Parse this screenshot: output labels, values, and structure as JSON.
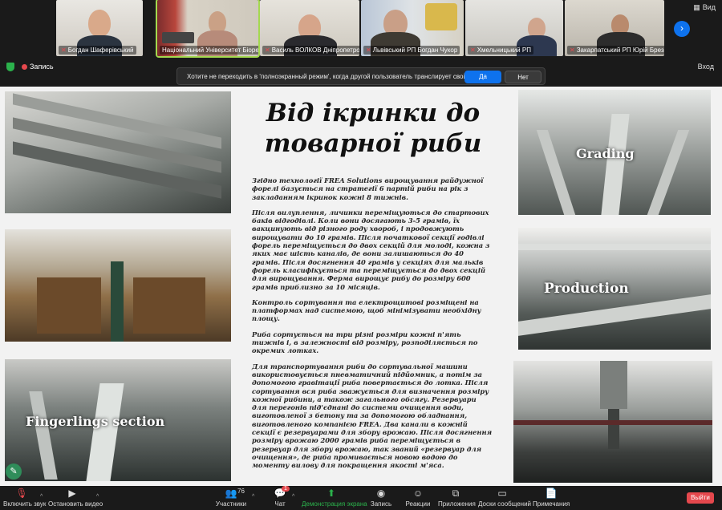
{
  "participants": [
    {
      "name": "Богдан Шаферівський"
    },
    {
      "name": "Національний Університет Біоресу..."
    },
    {
      "name": "Василь ВОЛКОВ Дніпропетровс..."
    },
    {
      "name": "Львівський РП Богдан Чукор"
    },
    {
      "name": "Хмельницький РП"
    },
    {
      "name": "Закарпатський РП Юрій Бреза"
    }
  ],
  "top_controls": {
    "view_label": "Вид",
    "exit_fullscreen_label": "Вход"
  },
  "recording": {
    "label": "Запись"
  },
  "prompt": {
    "question": "Хотите не переходить в 'полноэкранный режим', когда другой пользователь транслирует свой экран?",
    "yes_label": "Да",
    "no_label": "Нет"
  },
  "slide": {
    "title_line1": "Від ікринки до",
    "title_line2": "товарної риби",
    "paragraphs": [
      "Згідно технології FREA Solutions вирощування райдужної форелі базується на стратегії 6 партій риби на рік з закладанням ікринок кожні 8 тижнів.",
      "Після вилуплення, личинки переміщуються до стартових баків відгодівлі. Коли вони досягають 3-5 грамів, їх вакцинують від різного роду хвороб, і продовжують вирощувати до 10 грамів. Після початкової секції годівлі форель переміщується до двох секцій для молоді, кожна з яких має шість каналів, де вони залишаються до 40 грамів. Після досягнення 40 грамів у секціях для мальків форель класифікується та переміщується до двох секцій для вирощування. Ферма вирощує рибу до розміру 600 грамів приблизно за 10 місяців.",
      "Контроль сортування та електрощитові розміщені на платформах над системою, щоб мінімізувати необхідну площу.",
      "Риба сортується на три різні розміри кожні п'ять тижнів і, в залежності від розміру, розподіляється по окремих лотках.",
      "Для транспортування риби до сортувальної машини використовується пневматичний підйомник, а потім за допомогою гравітації риба повертається до лотка. Після сортування вся риба зважується для визначення розміру кожної рибини, а також загального обсягу. Резервуари для перегонів під'єднані до системи очищення води, виготовленої з бетону та за допомогою обладнання, виготовленого компанією FREA. Два канали в кожній секції є резервуарами для збору врожаю. Після досягнення розміру врожаю 2000 грамів риба переміщується в резервуар для збору врожаю, так званий «резервуар для очищення», де риба промивається новою водою до моменту вилову для покращення якості м'яса."
    ],
    "photo_labels": {
      "grading": "Grading",
      "production": "Production",
      "fingerlings": "Fingerlings section"
    }
  },
  "toolbar": {
    "mic_label": "Включить звук",
    "video_label": "Остановить видео",
    "participants_label": "Участники",
    "participants_count": "76",
    "chat_label": "Чат",
    "chat_badge": "1",
    "share_label": "Демонстрация экрана",
    "record_label": "Запись",
    "reactions_label": "Реакции",
    "apps_label": "Приложения",
    "whiteboard_label": "Доски сообщений",
    "notes_label": "Примечания",
    "leave_label": "Выйти"
  }
}
